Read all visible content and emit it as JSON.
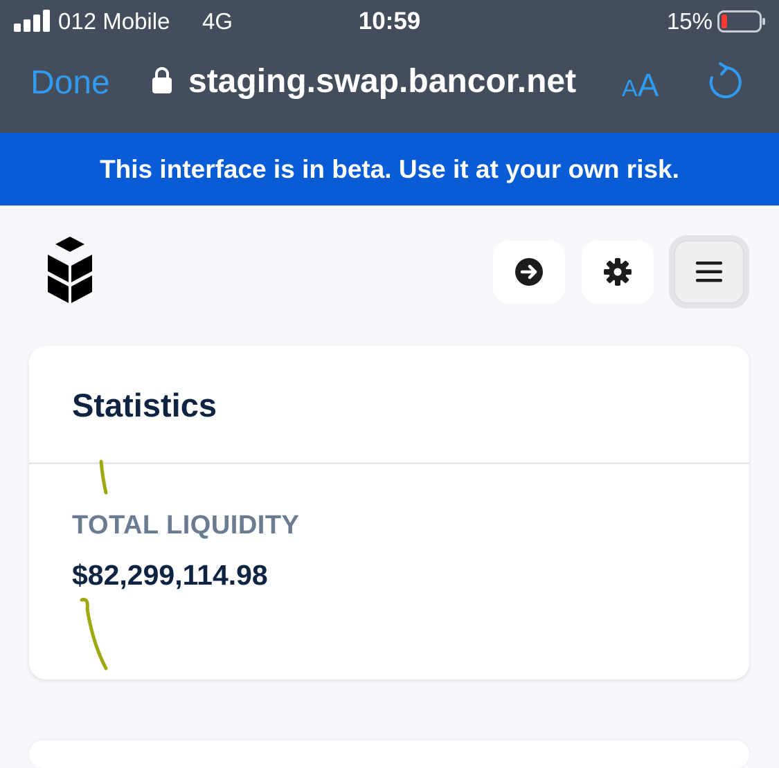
{
  "status_bar": {
    "carrier": "012 Mobile",
    "network": "4G",
    "time": "10:59",
    "battery_percent": "15%",
    "battery_level": 0.15,
    "signal_bars": 4
  },
  "browser": {
    "done_label": "Done",
    "url": "staging.swap.bancor.net",
    "text_size_small": "A",
    "text_size_big": "A",
    "accent_color": "#2f9bf3"
  },
  "banner": {
    "text": "This interface is in beta. Use it at your own risk.",
    "color": "#0a5cd6"
  },
  "header": {
    "logo_icon": "bancor-logo-icon",
    "buttons": [
      {
        "name": "login-button",
        "icon": "arrow-right-circle-icon"
      },
      {
        "name": "settings-button",
        "icon": "gear-icon"
      },
      {
        "name": "menu-button",
        "icon": "hamburger-menu-icon"
      }
    ]
  },
  "statistics": {
    "title": "Statistics",
    "total_liquidity_label": "TOTAL LIQUIDITY",
    "total_liquidity_value": "$82,299,114.98"
  }
}
